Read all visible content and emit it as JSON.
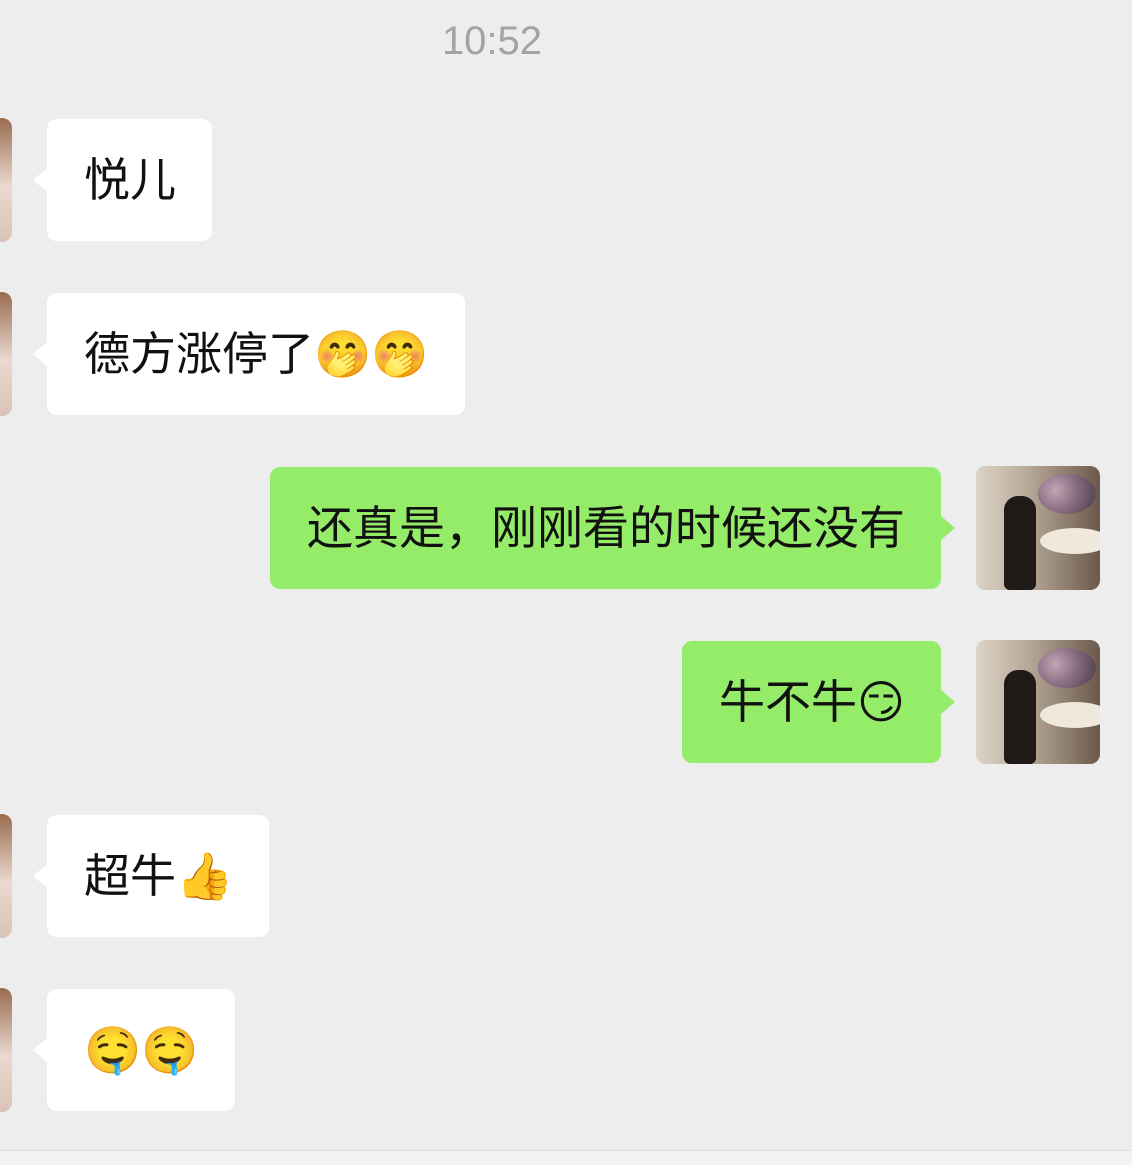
{
  "timestamp": "10:52",
  "messages": [
    {
      "side": "in",
      "text": "悦儿"
    },
    {
      "side": "in",
      "text": "德方涨停了🤭🤭"
    },
    {
      "side": "out",
      "text": "还真是，刚刚看的时候还没有"
    },
    {
      "side": "out",
      "text": "牛不牛😏"
    },
    {
      "side": "in",
      "text": "超牛👍"
    },
    {
      "side": "in",
      "text": "🤤🤤"
    }
  ],
  "colors": {
    "background": "#ededed",
    "incoming_bubble": "#ffffff",
    "outgoing_bubble": "#95ec69",
    "timestamp": "#a3a3a3"
  }
}
